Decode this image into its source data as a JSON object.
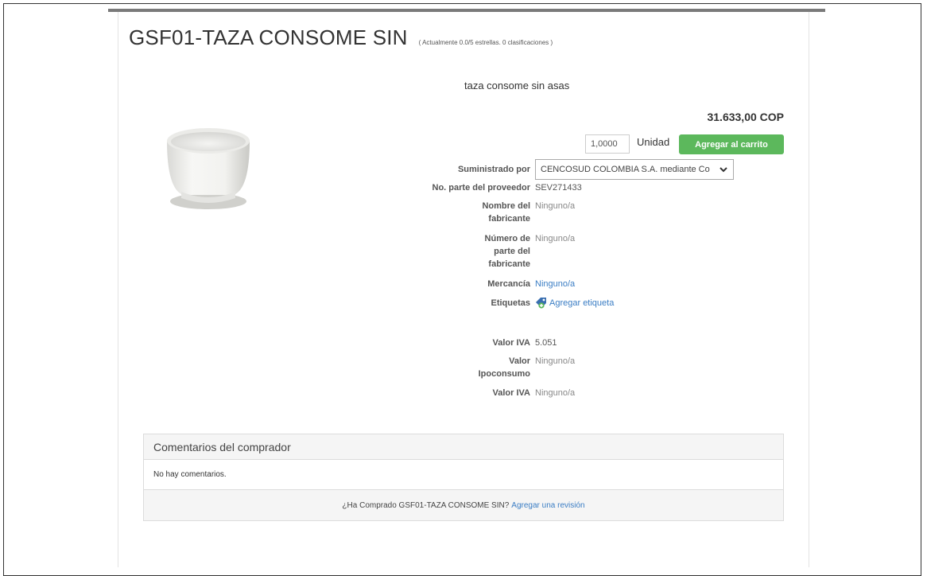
{
  "product": {
    "title": "GSF01-TAZA CONSOME SIN",
    "rating": "( Actualmente 0.0/5 estrellas. 0 clasificaciones )",
    "description": "taza consome sin asas",
    "price": "31.633,00 COP",
    "quantity": "1,0000",
    "unit": "Unidad",
    "add_to_cart": "Agregar al carrito"
  },
  "properties": {
    "supplier_label": "Suministrado por",
    "supplier_value": "CENCOSUD COLOMBIA S.A. mediante Co",
    "supplier_part_label": "No. parte del proveedor",
    "supplier_part_value": "SEV271433",
    "manufacturer_name_label": "Nombre del fabricante",
    "manufacturer_name_value": "Ninguno/a",
    "manufacturer_part_label": "Número de parte del fabricante",
    "manufacturer_part_value": "Ninguno/a",
    "commodity_label": "Mercancía",
    "commodity_value": "Ninguno/a",
    "tags_label": "Etiquetas",
    "tags_action": "Agregar etiqueta",
    "iva_label": "Valor IVA",
    "iva_value": "5.051",
    "ipoconsumo_label": "Valor Ipoconsumo",
    "ipoconsumo_value": "Ninguno/a",
    "iva2_label": "Valor IVA",
    "iva2_value": "Ninguno/a"
  },
  "comments": {
    "heading": "Comentarios del comprador",
    "empty": "No hay comentarios.",
    "prompt": "¿Ha Comprado GSF01-TAZA CONSOME SIN?",
    "review_link": "Agregar una revisión"
  },
  "colors": {
    "primary_button": "#5cb85c",
    "link": "#3a7dc4"
  },
  "icons": {
    "tag": "tag-add-icon",
    "dropdown": "chevron-down-icon"
  }
}
